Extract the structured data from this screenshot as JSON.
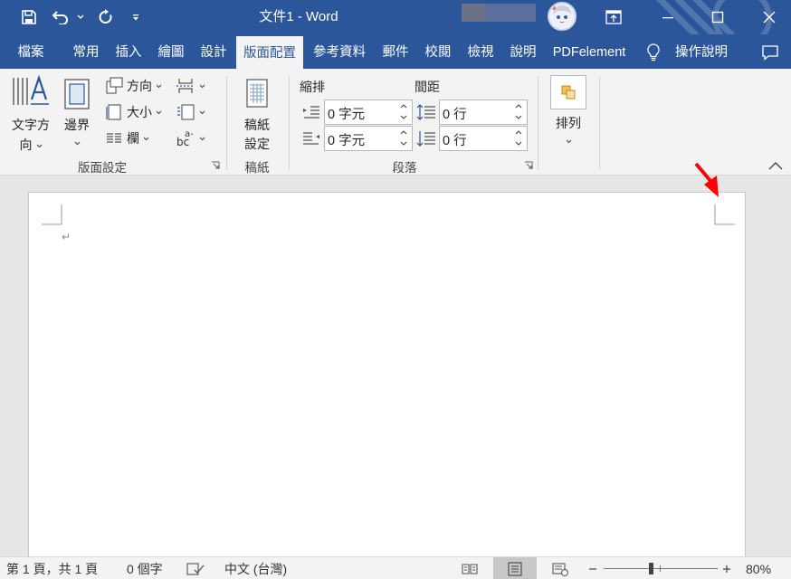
{
  "titlebar": {
    "doc_title": "文件1 - Word",
    "save_icon": "save-icon",
    "undo_icon": "undo-icon",
    "redo_icon": "redo-icon",
    "customize_icon": "customize-quick-access-icon"
  },
  "menubar": {
    "tabs": [
      "檔案",
      "常用",
      "插入",
      "繪圖",
      "設計",
      "版面配置",
      "參考資料",
      "郵件",
      "校閱",
      "檢視",
      "說明",
      "PDFelement"
    ],
    "active_tab": "版面配置",
    "tell_me": "操作說明"
  },
  "ribbon": {
    "page_setup": {
      "text_direction": [
        "文字方",
        "向"
      ],
      "margins": "邊界",
      "orientation": "方向",
      "size": "大小",
      "columns": "欄",
      "breaks_icon": "breaks-icon",
      "line_numbers_icon": "line-numbers-icon",
      "hyphenation_icon": "hyphenation-icon",
      "group_label": "版面設定"
    },
    "manuscript": {
      "button": [
        "稿紙",
        "設定"
      ],
      "group_label": "稿紙"
    },
    "paragraph": {
      "indent_label": "縮排",
      "spacing_label": "間距",
      "indent_left": "0 字元",
      "indent_right": "0 字元",
      "spacing_before": "0 行",
      "spacing_after": "0 行",
      "group_label": "段落"
    },
    "arrange": {
      "button": "排列"
    }
  },
  "document": {
    "paragraph_mark": "↵"
  },
  "statusbar": {
    "page_info": "第 1 頁，共 1 頁",
    "word_count": "0 個字",
    "language": "中文 (台灣)",
    "zoom_level": "80%",
    "zoom_fraction": 0.42
  },
  "colors": {
    "accent": "#2b579a",
    "ribbon_bg": "#f3f3f3",
    "annotation_arrow": "#ff0000"
  }
}
